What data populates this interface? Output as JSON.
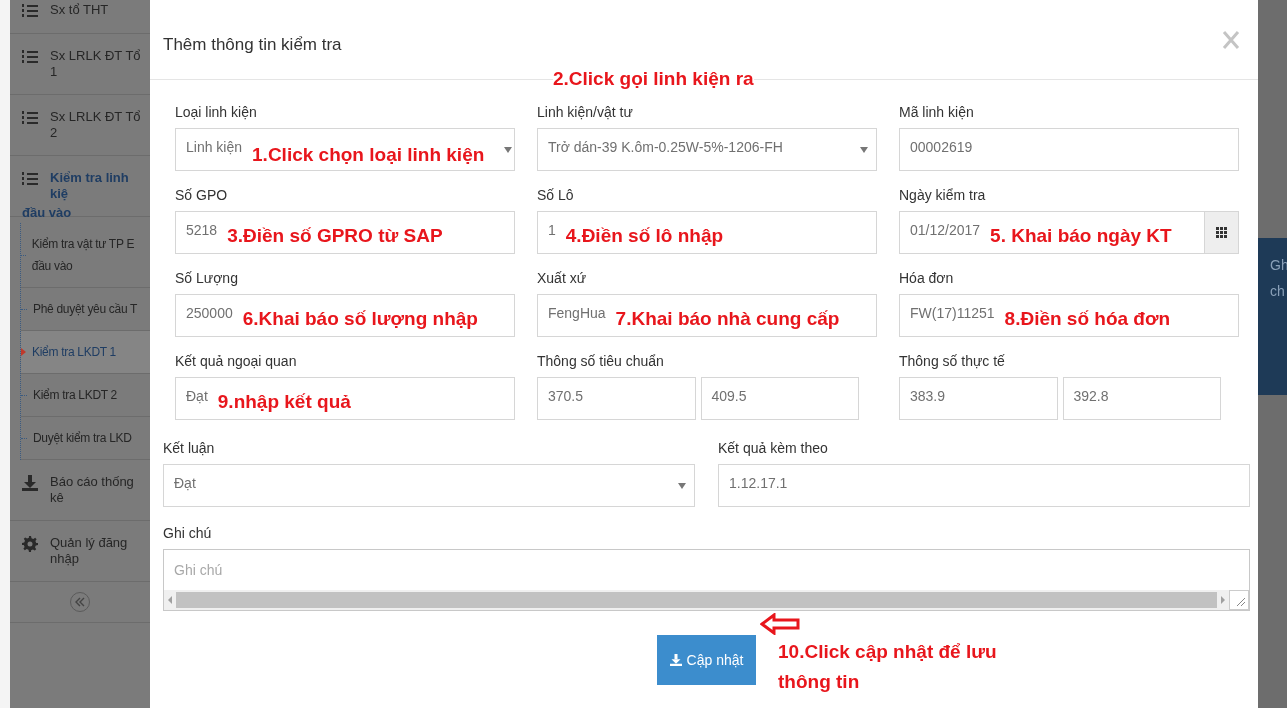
{
  "sidebar": {
    "items": [
      {
        "label": "Sx tổ THT",
        "kind": "menu",
        "selected": false
      },
      {
        "label": "Sx LRLK ĐT Tổ 1",
        "kind": "menu",
        "selected": false
      },
      {
        "label": "Sx LRLK ĐT Tổ 2",
        "kind": "menu",
        "selected": false
      },
      {
        "label": "Kiểm tra linh kiệ",
        "label_cont": "đầu vào",
        "kind": "menu",
        "selected": true,
        "children": [
          {
            "label": "Kiểm tra vật tư TP E đầu vào",
            "selected": false
          },
          {
            "label": "Phê duyệt yêu cầu T",
            "selected": false
          },
          {
            "label": "Kiểm tra LKDT 1",
            "selected": true
          },
          {
            "label": "Kiểm tra LKDT 2",
            "selected": false
          },
          {
            "label": "Duyệt kiểm tra LKD",
            "selected": false
          }
        ]
      },
      {
        "label": "Báo cáo thống kê",
        "kind": "report",
        "selected": false
      },
      {
        "label": "Quản lý đăng nhập",
        "kind": "settings",
        "selected": false
      }
    ]
  },
  "modal": {
    "title": "Thêm thông tin kiểm tra",
    "top_note": "2.Click gọi linh kiện ra",
    "fields": [
      {
        "label": "Loại linh kiện",
        "kind": "select",
        "value": "Linh kiện",
        "note": "1.Click chọn loại linh kiện"
      },
      {
        "label": "Linh kiện/vật tư",
        "kind": "select",
        "value": "Trở dán-39 K.ôm-0.25W-5%-1206-FH"
      },
      {
        "label": "Mã linh kiện",
        "kind": "input",
        "value": "00002619"
      },
      {
        "label": "Số GPO",
        "kind": "input",
        "value": "5218",
        "note": "3.Điền số GPRO từ SAP"
      },
      {
        "label": "Số Lô",
        "kind": "input",
        "value": "1",
        "note": "4.Điền số lô nhập"
      },
      {
        "label": "Ngày kiểm tra",
        "kind": "date",
        "value": "01/12/2017",
        "note": "5. Khai báo ngày KT"
      },
      {
        "label": "Số Lượng",
        "kind": "input",
        "value": "250000",
        "note": "6.Khai báo số lượng nhập"
      },
      {
        "label": "Xuất xứ",
        "kind": "input",
        "value": "FengHua",
        "note": "7.Khai báo nhà cung cấp"
      },
      {
        "label": "Hóa đơn",
        "kind": "input",
        "value": "FW(17)11251",
        "note": "8.Điền số hóa đơn"
      },
      {
        "label": "Kết quả ngoại quan",
        "kind": "input",
        "value": "Đạt",
        "note": "9.nhập kết quả"
      },
      {
        "label": "Thông số tiêu chuẩn",
        "kind": "pair",
        "values": [
          "370.5",
          "409.5"
        ]
      },
      {
        "label": "Thông số thực tế",
        "kind": "pair",
        "values": [
          "383.9",
          "392.8"
        ]
      }
    ],
    "wide_fields": [
      {
        "label": "Kết luận",
        "kind": "select",
        "value": "Đạt"
      },
      {
        "label": "Kết quả kèm theo",
        "kind": "input",
        "value": "1.12.17.1"
      }
    ],
    "notes_field": {
      "label": "Ghi chú",
      "placeholder": "Ghi chú"
    },
    "save_button": "Cập nhật",
    "save_note": "10.Click cập nhật để lưu thông tin"
  },
  "right_panel": {
    "lines": [
      "Gh",
      "ch"
    ]
  }
}
